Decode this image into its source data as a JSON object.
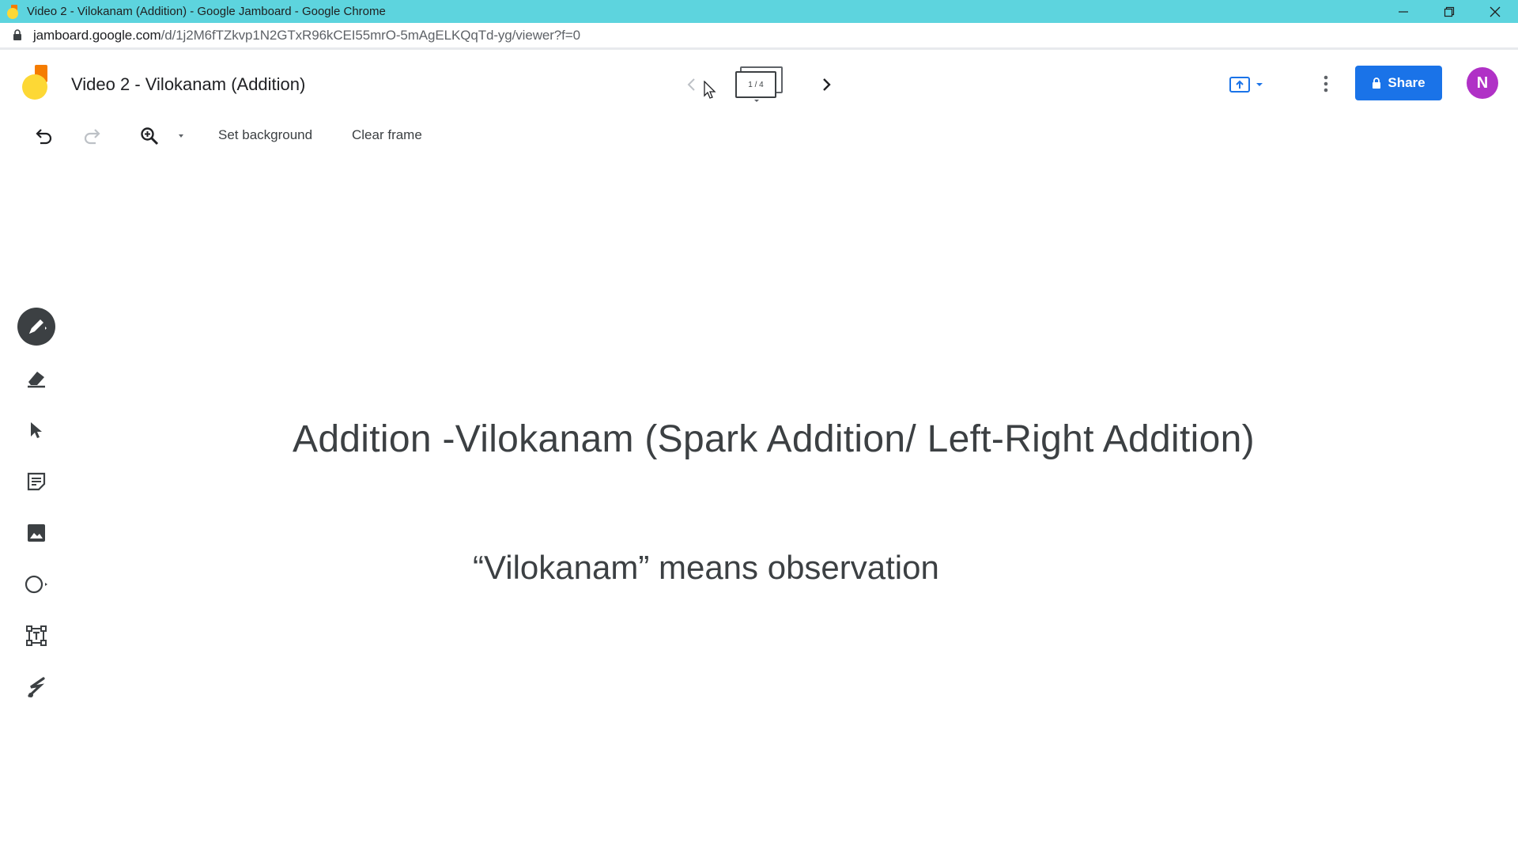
{
  "window": {
    "title": "Video 2 - Vilokanam (Addition) - Google Jamboard - Google Chrome",
    "controls": [
      "minimize-icon",
      "restore-icon",
      "close-icon"
    ]
  },
  "address_bar": {
    "host": "jamboard.google.com",
    "path": "/d/1j2M6fTZkvp1N2GTxR96kCEI55mrO-5mAgELKQqTd-yg/viewer?f=0"
  },
  "header": {
    "doc_title": "Video 2 - Vilokanam (Addition)",
    "frame_indicator": "1 / 4",
    "share_label": "Share",
    "avatar_initial": "N"
  },
  "toolbar": {
    "set_background": "Set background",
    "clear_frame": "Clear frame"
  },
  "tools": [
    "pen-icon",
    "eraser-icon",
    "select-icon",
    "sticky-note-icon",
    "image-icon",
    "circle-icon",
    "text-box-icon",
    "laser-icon"
  ],
  "canvas": {
    "headline": "Addition -Vilokanam (Spark Addition/ Left-Right Addition)",
    "subline": "“Vilokanam” means observation"
  },
  "colors": {
    "titlebar": "#5dd4de",
    "share_button": "#1a73e8",
    "avatar": "#b031c6",
    "logo_orange": "#f57c00",
    "logo_yellow": "#fdd835"
  }
}
